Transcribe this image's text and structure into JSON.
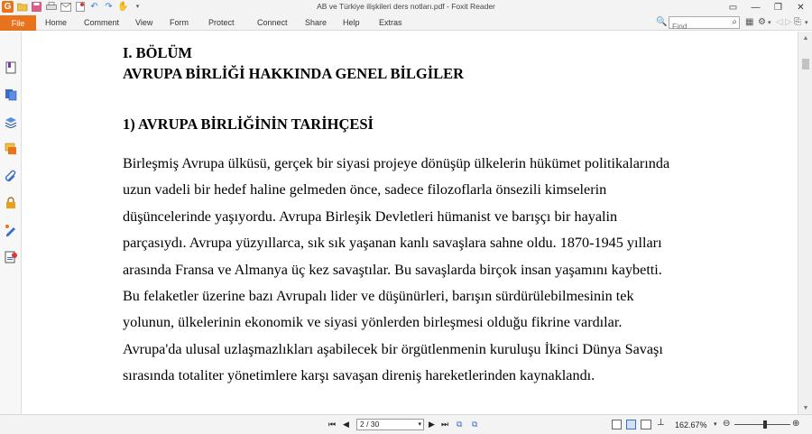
{
  "window": {
    "title": "AB ve Türkiye ilişkileri ders notları.pdf - Foxit Reader",
    "controls": [
      "—",
      "❐",
      "✕"
    ]
  },
  "menu": {
    "file_label": "File",
    "items": [
      "Home",
      "Comment",
      "View",
      "Form",
      "Protect",
      "Connect",
      "Share",
      "Help",
      "Extras"
    ]
  },
  "search": {
    "placeholder": "Find",
    "value": ""
  },
  "document": {
    "heading_1": "I. BÖLÜM",
    "heading_2": "AVRUPA BİRLİĞİ HAKKINDA GENEL BİLGİLER",
    "section_title": "1) AVRUPA BİRLİĞİNİN TARİHÇESİ",
    "paragraph_lines": [
      "Birleşmiş Avrupa ülküsü, gerçek bir siyasi projeye dönüşüp ülkelerin hükümet politikalarında",
      "uzun vadeli bir hedef haline gelmeden önce, sadece filozoflarla önsezili kimselerin",
      "düşüncelerinde yaşıyordu. Avrupa Birleşik Devletleri hümanist ve barışçı bir hayalin",
      "parçasıydı. Avrupa yüzyıllarca, sık sık yaşanan kanlı savaşlara sahne oldu. 1870-1945 yılları",
      "arasında Fransa ve Almanya üç kez savaştılar. Bu savaşlarda birçok insan yaşamını kaybetti.",
      "Bu felaketler üzerine bazı Avrupalı lider ve düşünürleri, barışın sürdürülebilmesinin tek",
      "yolunun, ülkelerinin ekonomik ve siyasi yönlerden birleşmesi olduğu fikrine vardılar.",
      "Avrupa'da ulusal uzlaşmazlıkları aşabilecek bir örgütlenmenin kuruluşu İkinci Dünya Savaşı",
      "sırasında totaliter yönetimlere karşı savaşan direniş hareketlerinden kaynaklandı."
    ]
  },
  "statusbar": {
    "page_indicator": "2 / 30",
    "zoom": "162.67%",
    "zoom_level_fraction": 0.52
  },
  "colors": {
    "accent": "#e8731c",
    "chrome_bg": "#f3f3f3"
  },
  "icons": [
    "app-logo-icon",
    "open-icon",
    "save-icon",
    "print-icon",
    "email-icon",
    "undo-icon",
    "redo-icon",
    "hand-tool-icon",
    "search-icon",
    "grid-icon",
    "gear-icon",
    "bookmark-icon",
    "pages-icon",
    "layers-icon",
    "comments-icon",
    "attachments-icon",
    "security-icon",
    "signature-icon",
    "info-icon"
  ]
}
